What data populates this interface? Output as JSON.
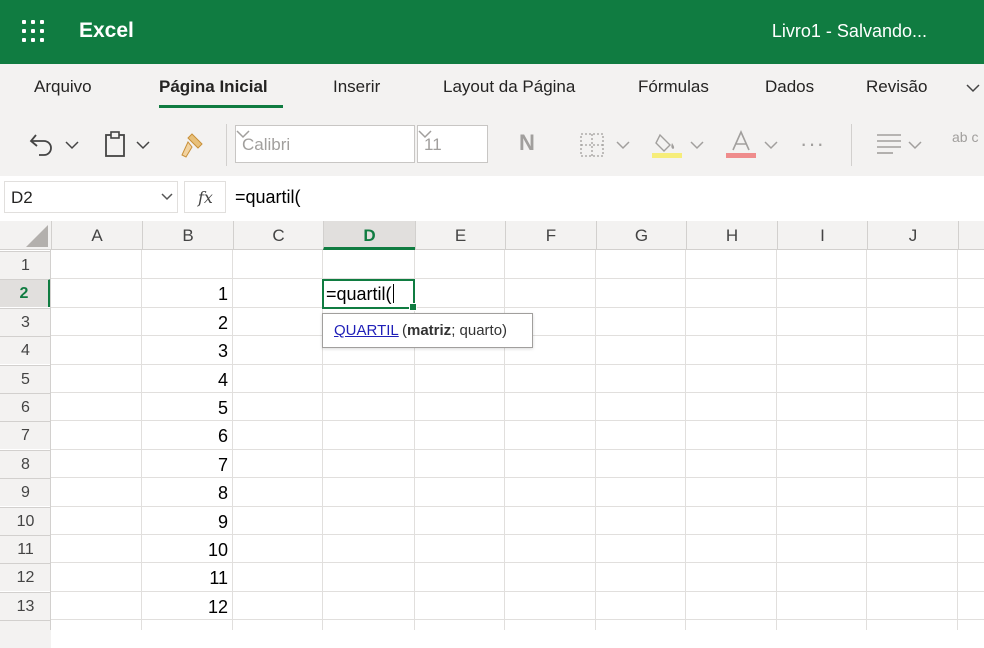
{
  "app": {
    "name": "Excel",
    "document_title": "Livro1  -  Salvando...",
    "brand_color": "#107c41"
  },
  "ribbon": {
    "tabs": [
      "Arquivo",
      "Página Inicial",
      "Inserir",
      "Layout da Página",
      "Fórmulas",
      "Dados",
      "Revisão"
    ],
    "active_tab": "Página Inicial",
    "font_name": "Calibri",
    "font_size": "11",
    "bold_label": "N",
    "wrap_label": "ab c",
    "more_label": "···"
  },
  "formula_bar": {
    "name_box": "D2",
    "fx_label": "fx",
    "formula": "=quartil("
  },
  "sheet": {
    "columns": [
      "A",
      "B",
      "C",
      "D",
      "E",
      "F",
      "G",
      "H",
      "I",
      "J"
    ],
    "active_column": "D",
    "rows": [
      "1",
      "2",
      "3",
      "4",
      "5",
      "6",
      "7",
      "8",
      "9",
      "10",
      "11",
      "12",
      "13"
    ],
    "active_row": "2",
    "column_b_values": [
      "1",
      "2",
      "3",
      "4",
      "5",
      "6",
      "7",
      "8",
      "9",
      "10",
      "11",
      "12"
    ],
    "active_cell_text": "=quartil("
  },
  "autocomplete": {
    "function": "QUARTIL",
    "open": " (",
    "arg1": "matriz",
    "rest": "; quarto)"
  }
}
